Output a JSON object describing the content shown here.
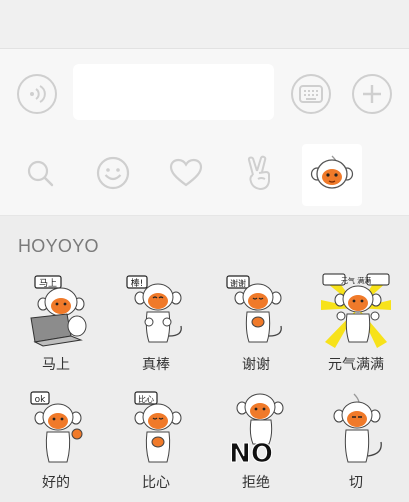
{
  "input_bar": {
    "voice_icon": "voice-wave-icon",
    "keyboard_icon": "keyboard-icon",
    "plus_icon": "plus-icon"
  },
  "toolbar": {
    "items": [
      "search-icon",
      "smiley-icon",
      "heart-icon",
      "peace-hand-icon",
      "monkey-sticker-pack-icon"
    ],
    "selected_index": 4
  },
  "panel": {
    "title": "HOYOYO",
    "stickers": [
      {
        "label": "马上",
        "badge": "马上"
      },
      {
        "label": "真棒",
        "badge": "棒!"
      },
      {
        "label": "谢谢",
        "badge": "谢谢"
      },
      {
        "label": "元气满满",
        "badge": "元气 满满"
      },
      {
        "label": "好的",
        "badge": "ok"
      },
      {
        "label": "比心",
        "badge": "比心"
      },
      {
        "label": "拒绝",
        "badge": "NO"
      },
      {
        "label": "切",
        "badge": ""
      }
    ]
  },
  "colors": {
    "background": "#ededed",
    "bar": "#f7f7f7",
    "icon_stroke": "#cfcfcf",
    "monkey_face": "#f07a2a",
    "label_text": "#333333",
    "title_text": "#7a7a7a"
  }
}
